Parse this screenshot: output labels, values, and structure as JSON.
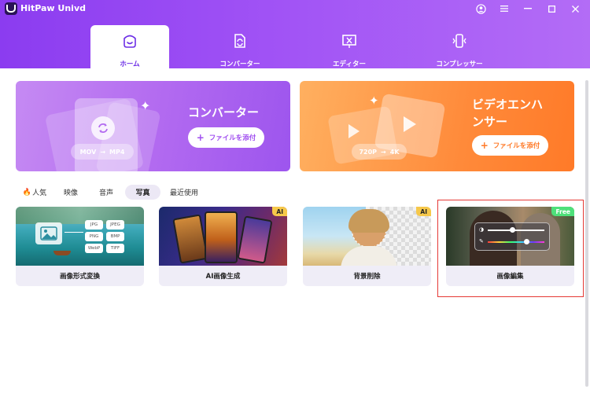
{
  "app": {
    "title": "HitPaw Univd"
  },
  "nav": {
    "tabs": [
      {
        "label": "ホーム",
        "icon": "home-icon",
        "active": true
      },
      {
        "label": "コンバーター",
        "icon": "convert-file-icon",
        "active": false
      },
      {
        "label": "エディター",
        "icon": "cut-icon",
        "active": false
      },
      {
        "label": "コンプレッサー",
        "icon": "compress-icon",
        "active": false
      }
    ]
  },
  "hero": {
    "converter": {
      "title": "コンバーター",
      "button": "ファイルを添付",
      "from": "MOV",
      "to": "MP4"
    },
    "enhancer": {
      "title_line1": "ビデオエンハ",
      "title_line2": "ンサー",
      "button": "ファイルを添付",
      "from": "720P",
      "to": "4K"
    }
  },
  "arrow_symbol": "→",
  "plus_symbol": "+",
  "categories": [
    {
      "label": "人気",
      "icon": "fire-icon",
      "active": false
    },
    {
      "label": "映像",
      "active": false
    },
    {
      "label": "音声",
      "active": false
    },
    {
      "label": "写真",
      "active": true
    },
    {
      "label": "最近使用",
      "active": false
    }
  ],
  "tools": [
    {
      "name": "画像形式変換",
      "badge": "",
      "formats": [
        "JPG",
        "JPEG",
        "PNG",
        "BMP",
        "WebP",
        "TIFF"
      ]
    },
    {
      "name": "AI画像生成",
      "badge": "AI"
    },
    {
      "name": "背景削除",
      "badge": "AI"
    },
    {
      "name": "画像編集",
      "badge": "Free",
      "highlighted": true
    }
  ],
  "colors": {
    "brand_purple": "#8b3cf0",
    "active_tab_text": "#6d2fe6",
    "converter_button_text": "#a04ef0",
    "enhancer_button_text": "#ff7a28",
    "highlight_border": "#e53935"
  }
}
